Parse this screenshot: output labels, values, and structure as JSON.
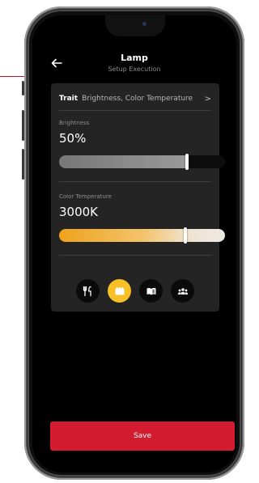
{
  "header": {
    "title": "Lamp",
    "subtitle": "Setup Execution",
    "back_icon": "arrow-left-icon"
  },
  "trait": {
    "label": "Trait",
    "value": "Brightness, Color Temperature",
    "chevron": ">"
  },
  "brightness": {
    "label": "Brightness",
    "value": "50%",
    "slider_level": 0.77
  },
  "color_temperature": {
    "label": "Color Temperature",
    "value": "3000K",
    "slider_level": 0.76
  },
  "modes": [
    {
      "icon": "dining-icon",
      "active": false
    },
    {
      "icon": "movie-icon",
      "active": true
    },
    {
      "icon": "reading-icon",
      "active": false
    },
    {
      "icon": "group-icon",
      "active": false
    }
  ],
  "actions": {
    "save_label": "Save"
  },
  "colors": {
    "accent": "#d41c31",
    "active_mode": "#f6c026",
    "card": "#242424"
  }
}
